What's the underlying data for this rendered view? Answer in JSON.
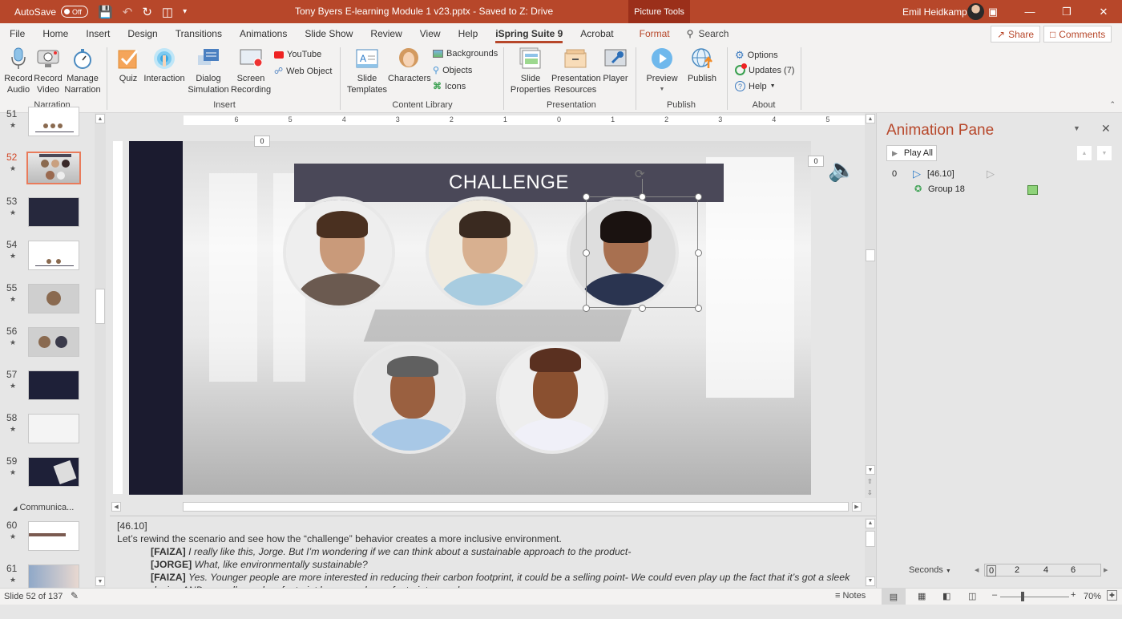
{
  "titlebar": {
    "autosave_label": "AutoSave",
    "autosave_state": "Off",
    "document_title": "Tony Byers E-learning Module 1 v23.pptx  -  Saved to Z: Drive",
    "context_tab": "Picture Tools",
    "user_name": "Emil Heidkamp"
  },
  "menu": {
    "tabs": [
      "File",
      "Home",
      "Insert",
      "Design",
      "Transitions",
      "Animations",
      "Slide Show",
      "Review",
      "View",
      "Help",
      "iSpring Suite 9",
      "Acrobat",
      "Format"
    ],
    "active_tab": "iSpring Suite 9",
    "search_label": "Search",
    "share_label": "Share",
    "comments_label": "Comments"
  },
  "ribbon": {
    "groups": [
      {
        "name": "Narration",
        "buttons": [
          "Record Audio",
          "Record Video",
          "Manage Narration"
        ]
      },
      {
        "name": "Insert",
        "buttons": [
          "Quiz",
          "Interaction",
          "Dialog Simulation",
          "Screen Recording"
        ],
        "small": [
          "YouTube",
          "Web Object"
        ]
      },
      {
        "name": "Content Library",
        "buttons": [
          "Slide Templates",
          "Characters"
        ],
        "small": [
          "Backgrounds",
          "Objects",
          "Icons"
        ]
      },
      {
        "name": "Presentation",
        "buttons": [
          "Slide Properties",
          "Presentation Resources",
          "Player"
        ]
      },
      {
        "name": "Publish",
        "buttons": [
          "Preview",
          "Publish"
        ]
      },
      {
        "name": "About",
        "small": [
          "Options",
          "Updates (7)",
          "Help"
        ]
      }
    ]
  },
  "slides_panel": {
    "items": [
      {
        "num": "51",
        "starred": true
      },
      {
        "num": "52",
        "starred": true,
        "selected": true
      },
      {
        "num": "53",
        "starred": true
      },
      {
        "num": "54",
        "starred": true
      },
      {
        "num": "55",
        "starred": true
      },
      {
        "num": "56",
        "starred": true
      },
      {
        "num": "57",
        "starred": true
      },
      {
        "num": "58",
        "starred": true
      },
      {
        "num": "59",
        "starred": true
      },
      {
        "num": "60",
        "starred": true
      },
      {
        "num": "61",
        "starred": true
      }
    ],
    "section_label": "Communica..."
  },
  "slide": {
    "title": "CHALLENGE",
    "tag_left": "0",
    "tag_right": "0"
  },
  "ruler": {
    "labels": [
      "6",
      "5",
      "4",
      "3",
      "2",
      "1",
      "0",
      "1",
      "2",
      "3",
      "4",
      "5",
      "6"
    ]
  },
  "notes": {
    "timestamp": "[46.10]",
    "intro": "Let’s rewind the scenario and see how the “challenge” behavior creates a more inclusive environment.",
    "lines": [
      {
        "speaker": "[FAIZA]",
        "text": "I really like this, Jorge.  But I’m wondering if we can think about a sustainable approach to the product-"
      },
      {
        "speaker": "[JORGE]",
        "text": "What, like environmentally sustainable?"
      },
      {
        "speaker": "[FAIZA]",
        "text": "Yes. Younger people are more interested in reducing their carbon footprint, it could be a selling point-  We could even play up the fact that it’s got a sleek design AND a smaller carbon footprint because shoe – footprint – you know"
      }
    ]
  },
  "animation_pane": {
    "title": "Animation Pane",
    "play_all_label": "Play All",
    "items": [
      {
        "index": "0",
        "label": "[46.10]"
      },
      {
        "index": "",
        "label": "Group 18"
      }
    ],
    "timeline_unit": "Seconds",
    "timeline_ticks": [
      "0",
      "2",
      "4",
      "6"
    ]
  },
  "statusbar": {
    "slide_info": "Slide 52 of 137",
    "notes_label": "Notes",
    "zoom": "70%",
    "zoom_level_percent": 70
  }
}
